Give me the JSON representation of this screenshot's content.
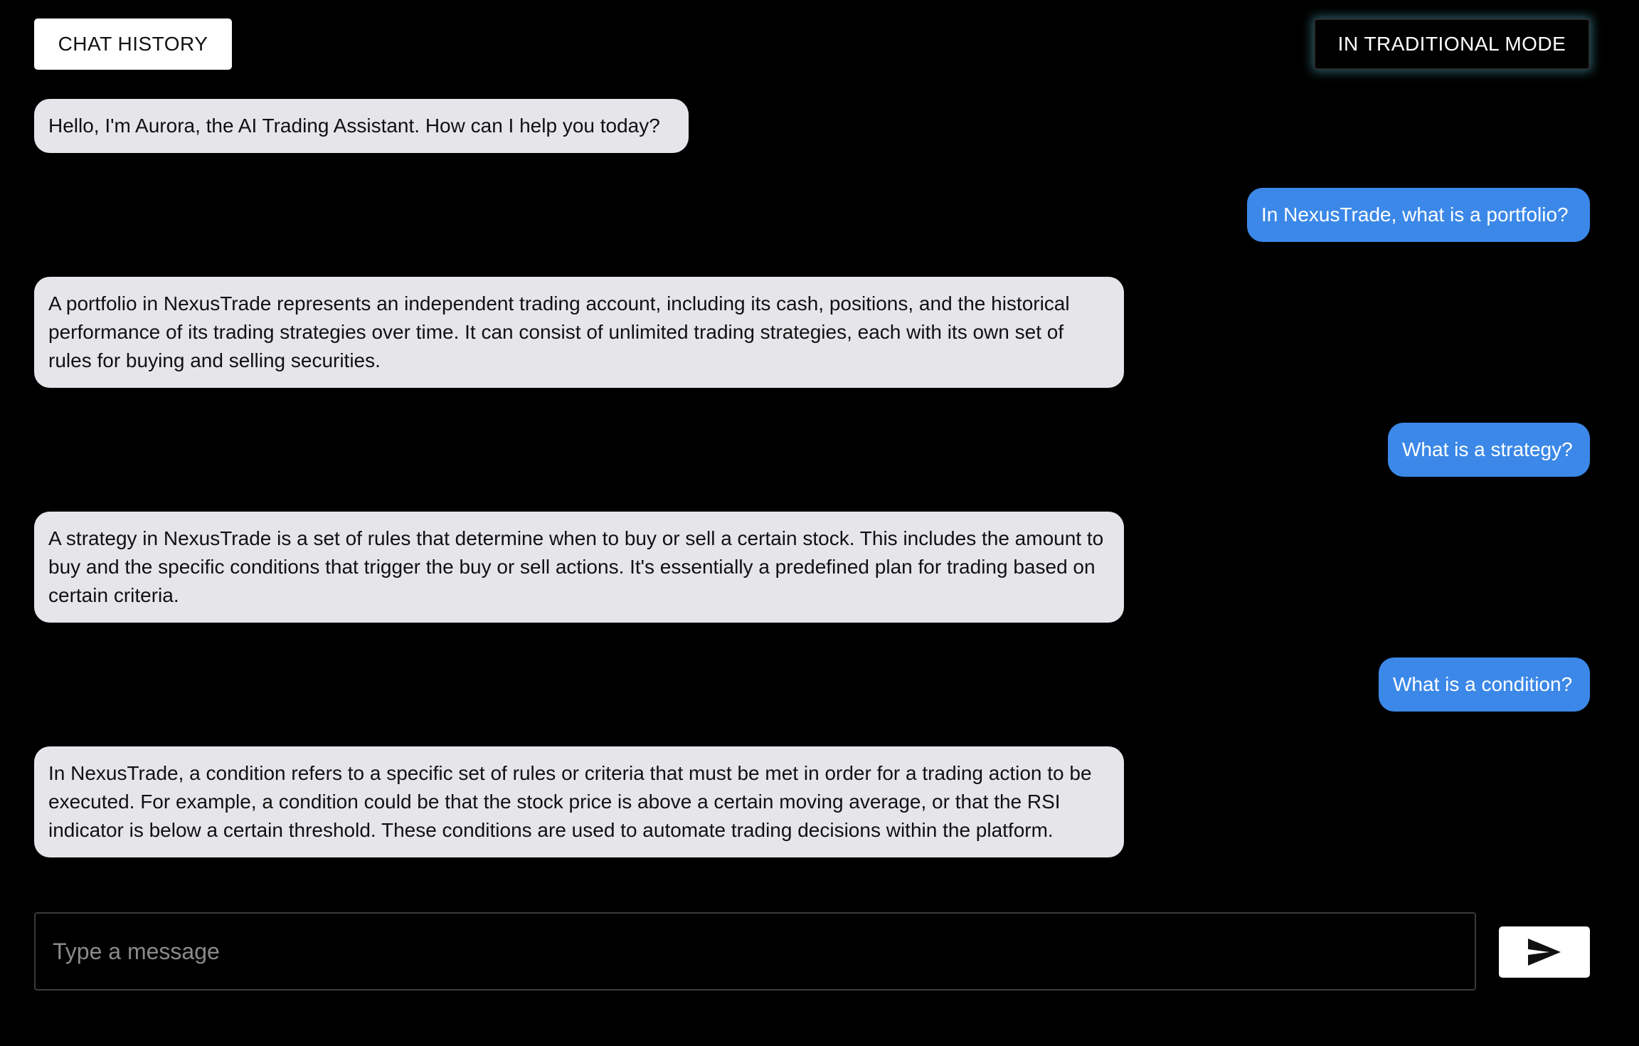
{
  "header": {
    "chat_history_label": "CHAT HISTORY",
    "mode_label": "IN TRADITIONAL MODE"
  },
  "messages": [
    {
      "role": "assistant",
      "text": "Hello, I'm Aurora, the AI Trading Assistant. How can I help you today?"
    },
    {
      "role": "user",
      "text": "In NexusTrade, what is a portfolio?"
    },
    {
      "role": "assistant",
      "text": "A portfolio in NexusTrade represents an independent trading account, including its cash, positions, and the historical performance of its trading strategies over time. It can consist of unlimited trading strategies, each with its own set of rules for buying and selling securities."
    },
    {
      "role": "user",
      "text": "What is a strategy?"
    },
    {
      "role": "assistant",
      "text": "A strategy in NexusTrade is a set of rules that determine when to buy or sell a certain stock. This includes the amount to buy and the specific conditions that trigger the buy or sell actions. It's essentially a predefined plan for trading based on certain criteria."
    },
    {
      "role": "user",
      "text": "What is a condition?"
    },
    {
      "role": "assistant",
      "text": "In NexusTrade, a condition refers to a specific set of rules or criteria that must be met in order for a trading action to be executed. For example, a condition could be that the stock price is above a certain moving average, or that the RSI indicator is below a certain threshold. These conditions are used to automate trading decisions within the platform."
    }
  ],
  "composer": {
    "placeholder": "Type a message",
    "value": "",
    "send_icon": "send-icon"
  },
  "colors": {
    "background": "#000000",
    "assistant_bubble": "#e6e6ea",
    "user_bubble": "#3b88e8",
    "mode_glow": "#5ac8dc"
  }
}
